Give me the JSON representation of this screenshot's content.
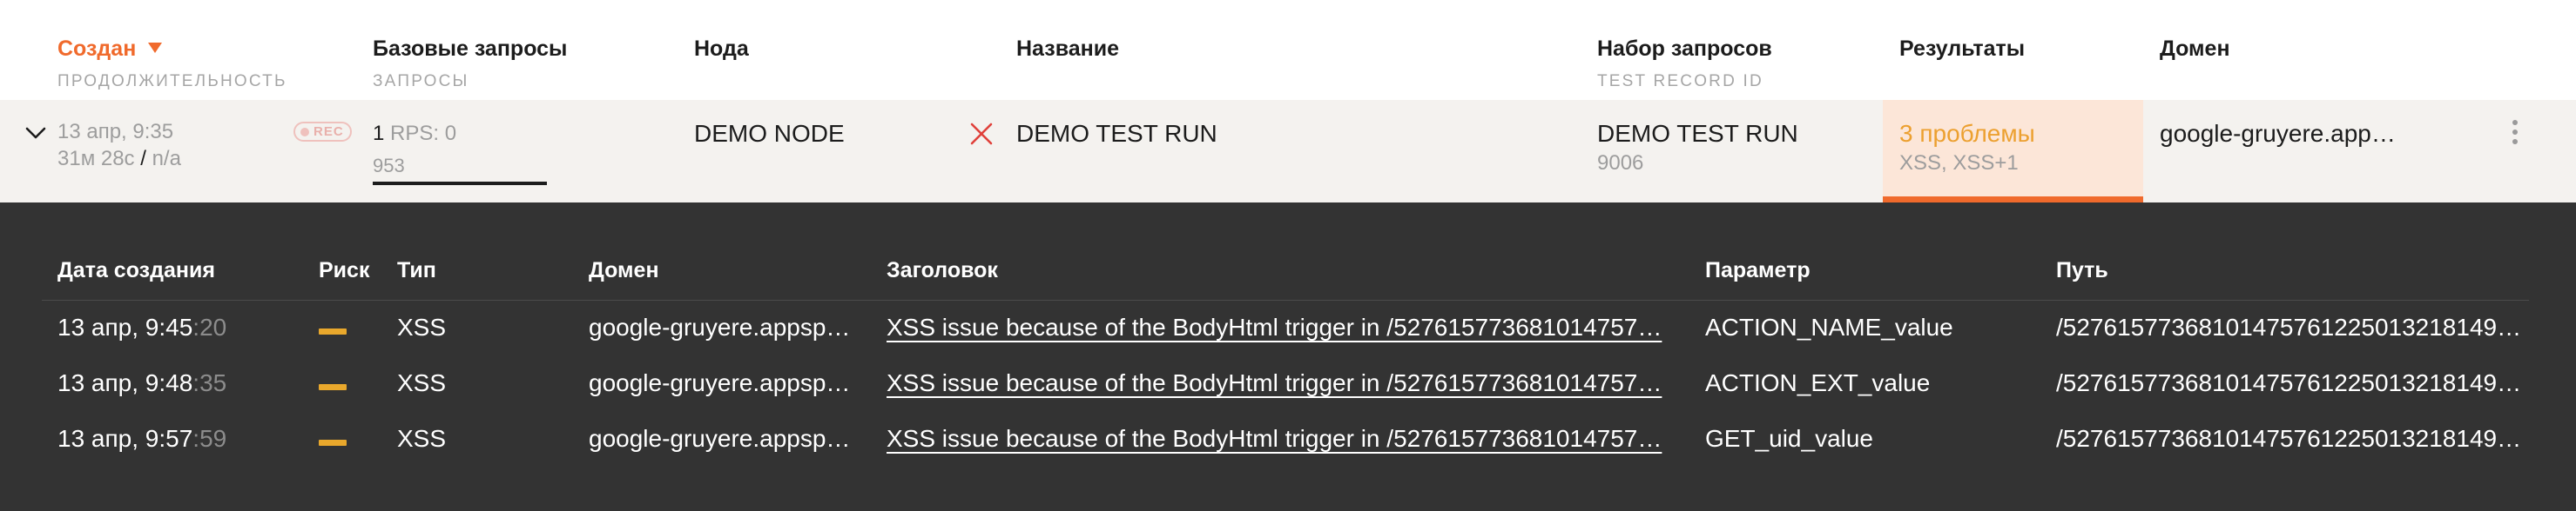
{
  "header": {
    "columns": [
      {
        "label": "Создан",
        "sub": "ПРОДОЛЖИТЕЛЬНОСТЬ",
        "sorted": true
      },
      {
        "label": "Базовые запросы",
        "sub": "ЗАПРОСЫ"
      },
      {
        "label": "Нода",
        "sub": ""
      },
      {
        "label": "Название",
        "sub": ""
      },
      {
        "label": "Набор запросов",
        "sub": "TEST RECORD ID"
      },
      {
        "label": "Результаты",
        "sub": ""
      },
      {
        "label": "Домен",
        "sub": ""
      }
    ]
  },
  "run": {
    "created": "13 апр, 9:35",
    "duration": "31м 28с",
    "duration_sep": "/",
    "duration_extra": "n/a",
    "badge": "REC",
    "base_requests_count": "1",
    "rps": "RPS: 0",
    "requests": "953",
    "progress_fraction": 1.0,
    "node": "DEMO NODE",
    "status_icon": "close-x-icon",
    "name": "DEMO TEST RUN",
    "request_set": "DEMO TEST RUN",
    "test_record_id": "9006",
    "results_title": "3 проблемы",
    "results_sub": "XSS, XSS+1",
    "domain": "google-gruyere.app…"
  },
  "details": {
    "columns": [
      "Дата создания",
      "Риск",
      "Тип",
      "Домен",
      "Заголовок",
      "Параметр",
      "Путь"
    ],
    "rows": [
      {
        "date_main": "13 апр, 9:45",
        "date_sec": ":20",
        "risk": "medium",
        "type": "XSS",
        "domain": "google-gruyere.appsp…",
        "title": "XSS issue because of the BodyHtml trigger in /527615773681014757…",
        "param": "ACTION_NAME_value",
        "path": "/52761577368101475761225013218149…"
      },
      {
        "date_main": "13 апр, 9:48",
        "date_sec": ":35",
        "risk": "medium",
        "type": "XSS",
        "domain": "google-gruyere.appsp…",
        "title": "XSS issue because of the BodyHtml trigger in /527615773681014757…",
        "param": "ACTION_EXT_value",
        "path": "/52761577368101475761225013218149…"
      },
      {
        "date_main": "13 апр, 9:57",
        "date_sec": ":59",
        "risk": "medium",
        "type": "XSS",
        "domain": "google-gruyere.appsp…",
        "title": "XSS issue because of the BodyHtml trigger in /527615773681014757…",
        "param": "GET_uid_value",
        "path": "/52761577368101475761225013218149…"
      }
    ]
  },
  "colors": {
    "accent": "#f06a2c",
    "warning": "#eca030",
    "panel_bg": "#333333",
    "row_bg": "#f4f2ef"
  }
}
